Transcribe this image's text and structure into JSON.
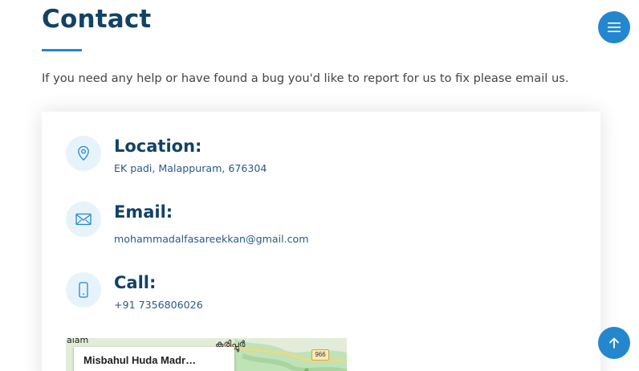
{
  "section": {
    "title": "Contact",
    "intro": "If you need any help or have found a bug you'd like to report for us to fix please email us."
  },
  "contact": {
    "location": {
      "heading": "Location:",
      "text": "EK padi, Malappuram, 676304",
      "icon": "map-pin-icon"
    },
    "email": {
      "heading": "Email:",
      "text": "mohammadalfasareekkan@gmail.com",
      "icon": "envelope-icon"
    },
    "call": {
      "heading": "Call:",
      "text": "+91 7356806026",
      "icon": "phone-icon"
    }
  },
  "map": {
    "place_name": "Misbahul Huda Madr…",
    "label_left": "alam",
    "label_place": "കരിപ്പൂർ",
    "road_number": "966"
  },
  "nav": {
    "menu_icon": "hamburger-icon",
    "back_to_top_icon": "arrow-up-icon"
  },
  "colors": {
    "accent": "#2487ce",
    "heading": "#124265",
    "icon_bg": "#e7f3fb"
  }
}
